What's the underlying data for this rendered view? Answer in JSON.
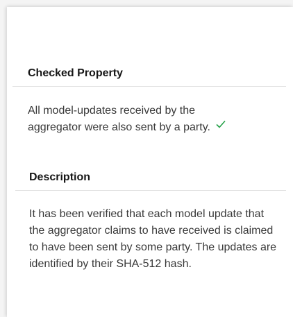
{
  "checked_property": {
    "title": "Checked Property",
    "text": "All model-updates received by the aggregator were also sent by a party.",
    "status_icon": "checkmark-icon",
    "status_color": "#24a148"
  },
  "description": {
    "title": "Description",
    "text": "It has been verified that each model update that the aggregator claims to have received is claimed to have been sent by some party. The updates are identified by their SHA-512 hash."
  }
}
